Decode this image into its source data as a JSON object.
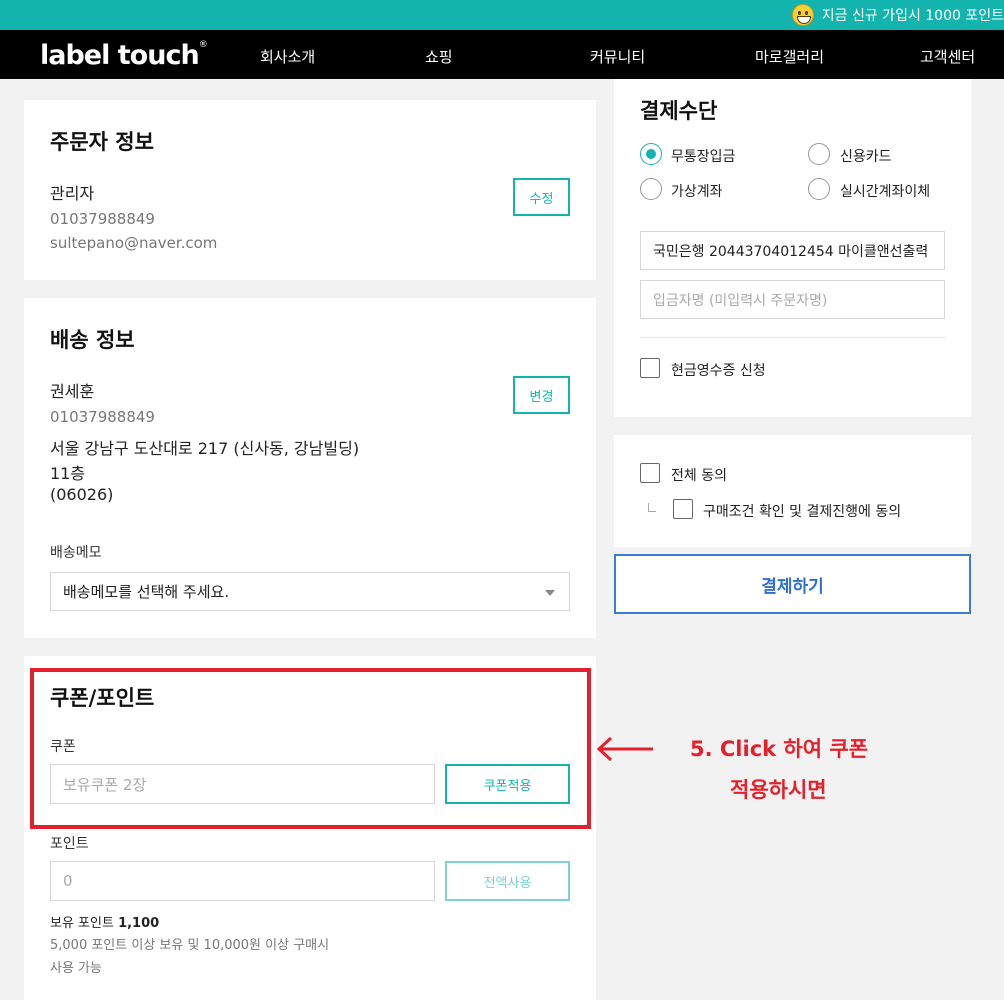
{
  "promo": {
    "text": "지금 신규 가입시 1000 포인트"
  },
  "nav": {
    "logo": "label touch",
    "logo_mark": "®",
    "items": [
      "회사소개",
      "쇼핑",
      "커뮤니티",
      "마로갤러리",
      "고객센터"
    ]
  },
  "orderer": {
    "title": "주문자 정보",
    "name": "관리자",
    "phone": "01037988849",
    "email": "sultepano@naver.com",
    "edit_label": "수정"
  },
  "shipping": {
    "title": "배송 정보",
    "name": "권세훈",
    "phone": "01037988849",
    "address_line1": "서울 강남구 도산대로 217 (신사동, 강남빌딩)",
    "address_line2": "11층",
    "zip": "(06026)",
    "change_label": "변경",
    "memo_label": "배송메모",
    "memo_value": "배송메모를 선택해 주세요."
  },
  "coupon_point": {
    "title": "쿠폰/포인트",
    "coupon_label": "쿠폰",
    "coupon_placeholder": "보유쿠폰 2장",
    "coupon_button": "쿠폰적용",
    "point_label": "포인트",
    "point_value": "0",
    "point_button": "전액사용",
    "owned_label": "보유 포인트",
    "owned_value": "1,100",
    "note_line1": "5,000 포인트 이상 보유 및 10,000원 이상 구매시",
    "note_line2": "사용 가능"
  },
  "payment": {
    "title": "결제수단",
    "methods": [
      "무통장입금",
      "신용카드",
      "가상계좌",
      "실시간계좌이체"
    ],
    "selected": "무통장입금",
    "bank_account": "국민은행 20443704012454 마이클앤선출력",
    "depositor_placeholder": "입금자명 (미입력시 주문자명)",
    "cash_receipt": "현금영수증 신청"
  },
  "agreement": {
    "all": "전체 동의",
    "purchase": "구매조건 확인 및 결제진행에 동의"
  },
  "pay_button": "결제하기",
  "annotation": {
    "line1": "5. Click 하여 쿠폰",
    "line2": "적용하시면",
    "color": "#e4202a"
  },
  "colors": {
    "accent": "#12b4ad",
    "pay_border": "#3b7ddd"
  }
}
